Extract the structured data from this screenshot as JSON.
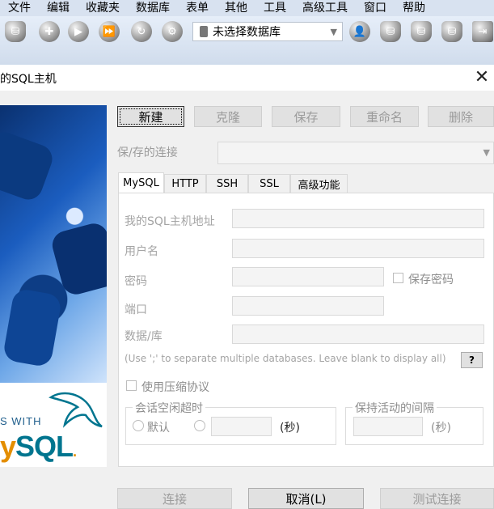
{
  "menu": [
    "文件",
    "编辑",
    "收藏夹",
    "数据库",
    "表单",
    "其他",
    "工具",
    "高级工具",
    "窗口",
    "帮助"
  ],
  "toolbar": {
    "db_select_value": "未选择数据库"
  },
  "dialog": {
    "title": "的SQL主机",
    "brand_tagline": "S WITH",
    "brand_logo_my": "y",
    "brand_logo_sql": "SQL",
    "brand_logo_tm": ".",
    "buttons": {
      "new": "新建",
      "clone": "克隆",
      "save": "保存",
      "rename": "重命名",
      "delete": "删除"
    },
    "saved_label": "保/存的连接",
    "tabs": [
      "MySQL",
      "HTTP",
      "SSH",
      "SSL",
      "高级功能"
    ],
    "fields": {
      "host_label": "我的SQL主机地址",
      "user_label": "用户名",
      "password_label": "密码",
      "save_password_label": "保存密码",
      "port_label": "端口",
      "database_label": "数据/库",
      "hint": "(Use ';' to separate multiple databases. Leave blank to display all)",
      "help_label": "?",
      "compression_label": "使用压缩协议"
    },
    "idle_group": {
      "title": "会话空闲超时",
      "default_label": "默认",
      "seconds_label": "(秒)"
    },
    "keepalive_group": {
      "title": "保持活动的间隔",
      "seconds_label": "(秒)"
    },
    "footer": {
      "connect": "连接",
      "cancel": "取消(L)",
      "test": "测试连接"
    }
  }
}
